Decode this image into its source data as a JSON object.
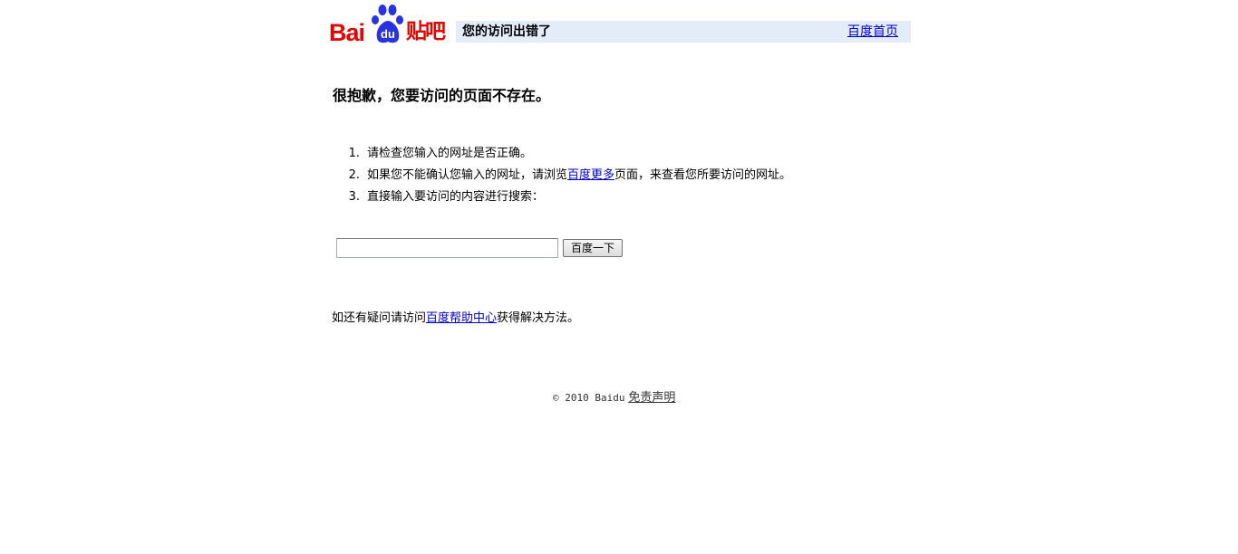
{
  "logo": {
    "latin_text": "Bai",
    "paw_text": "du",
    "cn_text": "贴吧"
  },
  "header": {
    "title": "您的访问出错了",
    "home_link": "百度首页"
  },
  "main": {
    "sorry_message": "很抱歉，您要访问的页面不存在。",
    "tips": [
      {
        "number": "1.",
        "text": "请检查您输入的网址是否正确。"
      },
      {
        "number": "2.",
        "before": "如果您不能确认您输入的网址，请浏览",
        "link": "百度更多",
        "after": "页面，来查看您所要访问的网址。"
      },
      {
        "number": "3.",
        "text": "直接输入要访问的内容进行搜索："
      }
    ]
  },
  "search": {
    "value": "",
    "button_label": "百度一下"
  },
  "help": {
    "before": "如还有疑问请访问",
    "link": "百度帮助中心",
    "after": "获得解决方法。"
  },
  "footer": {
    "copyright": "© 2010 Baidu",
    "disclaimer_link": "免责声明"
  },
  "colors": {
    "brand_red": "#e10602",
    "paw_blue": "#2932e1",
    "header_bg": "#e5ecf9",
    "link": "#0000cc"
  }
}
